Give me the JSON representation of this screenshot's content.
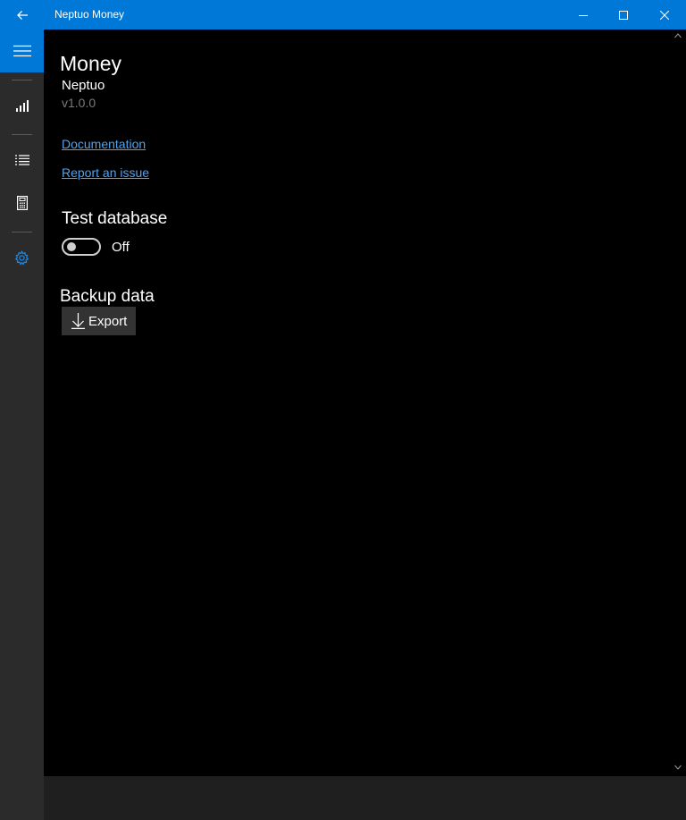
{
  "window": {
    "title": "Neptuo Money"
  },
  "titlebar": {
    "back_icon": "back-arrow-icon",
    "minimize_icon": "minimize-icon",
    "maximize_icon": "maximize-icon",
    "close_icon": "close-icon"
  },
  "sidebar": {
    "menu_icon": "hamburger-icon",
    "items": [
      {
        "icon": "bar-chart-icon",
        "selected": false
      },
      {
        "icon": "list-icon",
        "selected": false
      },
      {
        "icon": "calculator-icon",
        "selected": false
      },
      {
        "icon": "gear-icon",
        "selected": true
      }
    ],
    "accent_color": "#0078d7"
  },
  "about": {
    "app_name": "Money",
    "company": "Neptuo",
    "version": "v1.0.0",
    "documentation_link": "Documentation",
    "report_issue_link": "Report an issue"
  },
  "test_database": {
    "title": "Test database",
    "toggle_state": "Off"
  },
  "backup": {
    "title": "Backup data",
    "export_label": "Export",
    "export_icon": "download-icon"
  },
  "colors": {
    "accent": "#0078d7",
    "link": "#4fa3ee",
    "background": "#000000",
    "sidebar": "#2b2b2b"
  }
}
